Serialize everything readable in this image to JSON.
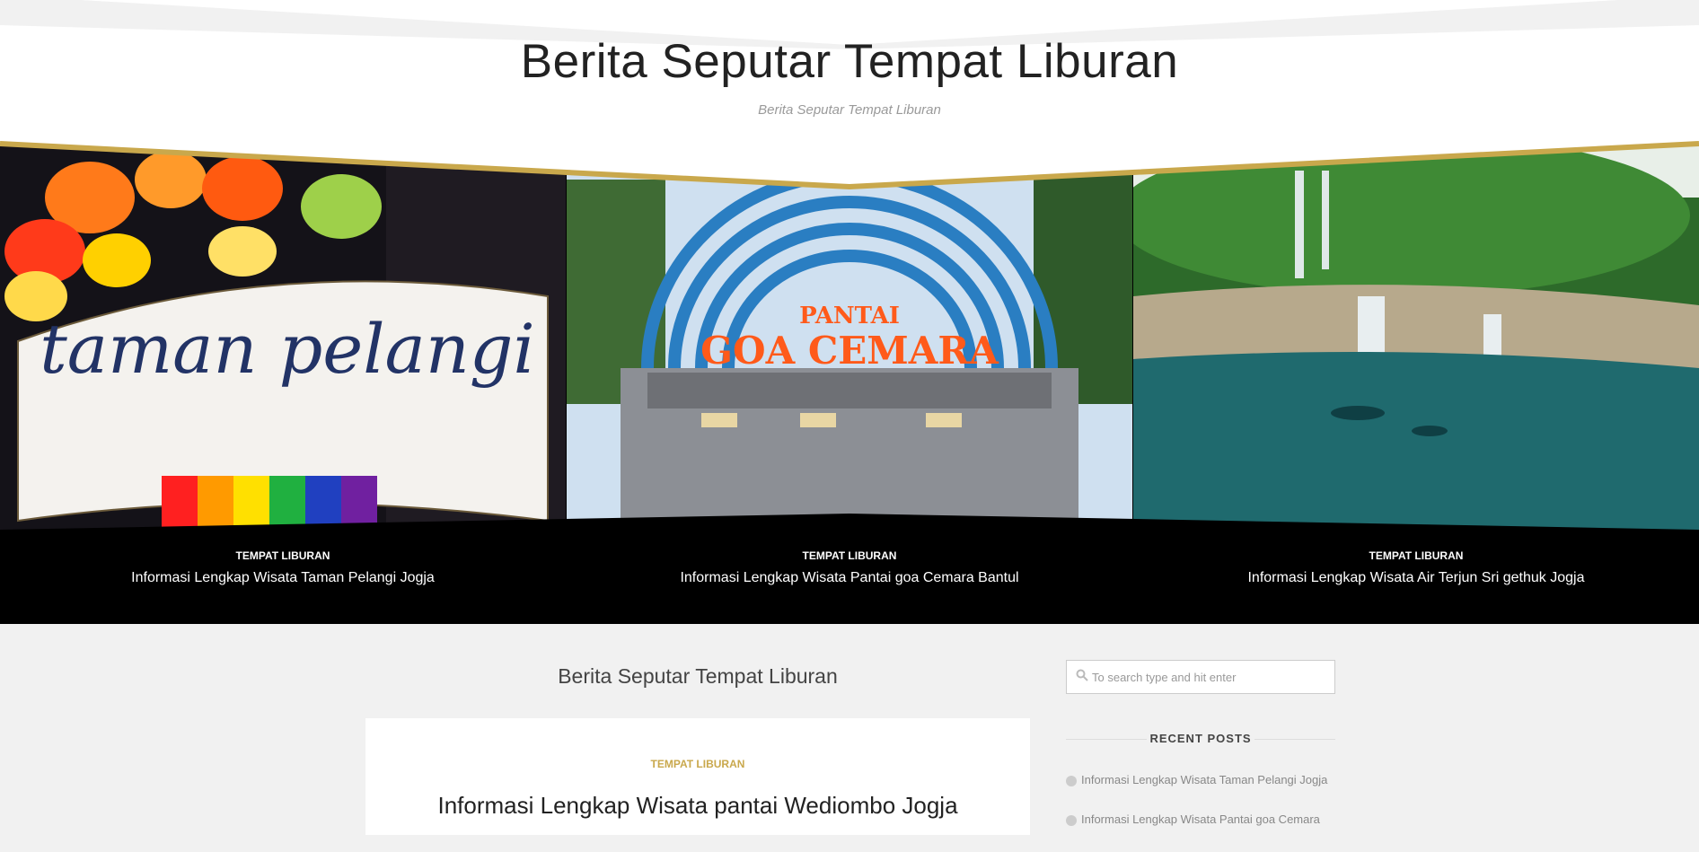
{
  "site": {
    "title": "Berita Seputar Tempat Liburan",
    "tagline": "Berita Seputar Tempat Liburan"
  },
  "slider": {
    "slides": [
      {
        "category": "TEMPAT LIBURAN",
        "title": "Informasi Lengkap Wisata Taman Pelangi Jogja",
        "image_text": "taman pelangi"
      },
      {
        "category": "TEMPAT LIBURAN",
        "title": "Informasi Lengkap Wisata Pantai goa Cemara Bantul",
        "image_text_top": "PANTAI",
        "image_text_main": "GOA CEMARA"
      },
      {
        "category": "TEMPAT LIBURAN",
        "title": "Informasi Lengkap Wisata Air Terjun Sri gethuk Jogja"
      }
    ]
  },
  "main": {
    "section_title": "Berita Seputar Tempat Liburan",
    "post": {
      "category": "TEMPAT LIBURAN",
      "title": "Informasi Lengkap Wisata pantai Wediombo Jogja"
    }
  },
  "sidebar": {
    "search": {
      "placeholder": "To search type and hit enter"
    },
    "recent_posts": {
      "title": "RECENT POSTS",
      "items": [
        "Informasi Lengkap Wisata Taman Pelangi Jogja",
        "Informasi Lengkap Wisata Pantai goa Cemara"
      ]
    }
  },
  "colors": {
    "accent": "#c9a84c",
    "page_bg": "#f1f1f1",
    "slider_bg": "#000000"
  }
}
